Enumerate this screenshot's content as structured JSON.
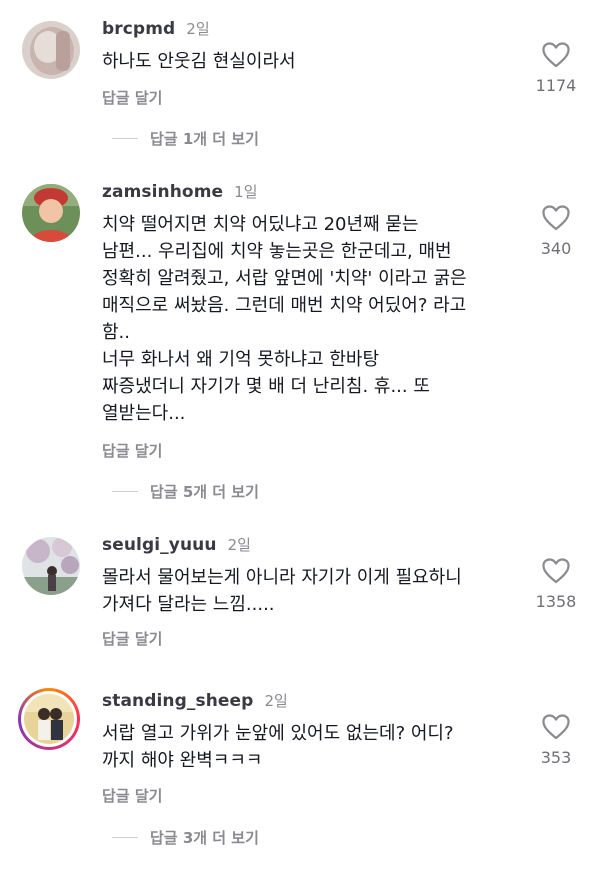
{
  "comments": [
    {
      "username": "brcpmd",
      "time": "2일",
      "text": "하나도 안웃김 현실이라서",
      "reply_label": "답글 달기",
      "likes": "1174",
      "view_replies": "답글 1개 더 보기"
    },
    {
      "username": "zamsinhome",
      "time": "1일",
      "text": "치약 떨어지면 치약 어딨냐고 20년째 묻는\n남편... 우리집에 치약 놓는곳은 한군데고, 매번\n정확히 알려줬고, 서랍 앞면에 '치약' 이라고 굵은\n매직으로 써놨음. 그런데 매번 치약 어딨어? 라고\n함..\n너무 화나서 왜 기억 못하냐고 한바탕\n짜증냈더니 자기가 몇 배 더 난리침.  휴... 또\n열받는다...",
      "reply_label": "답글 달기",
      "likes": "340",
      "view_replies": "답글 5개 더 보기"
    },
    {
      "username": "seulgi_yuuu",
      "time": "2일",
      "text": "몰라서 물어보는게 아니라 자기가 이게 필요하니\n가져다 달라는 느낌.....",
      "reply_label": "답글 달기",
      "likes": "1358"
    },
    {
      "username": "standing_sheep",
      "time": "2일",
      "text": "서랍 열고 가위가 눈앞에 있어도 없는데? 어디?\n까지 해야 완벽ㅋㅋㅋ",
      "reply_label": "답글 달기",
      "likes": "353",
      "view_replies": "답글 3개 더 보기"
    }
  ],
  "icons": {
    "like": "heart-outline-icon"
  },
  "colors": {
    "text": "#161823",
    "secondary": "#8a8b91",
    "like_count": "#6f7077"
  }
}
